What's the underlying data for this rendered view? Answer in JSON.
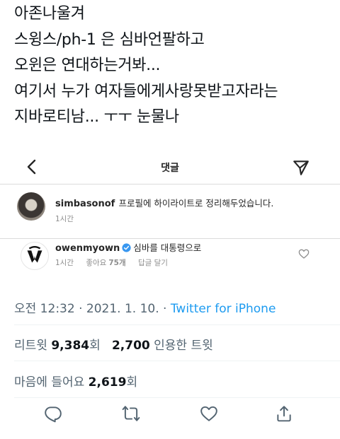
{
  "tweet": {
    "lines": [
      "아존나울겨",
      "스윙스/ph-1 은 심바언팔하고",
      "오윈은 연대하는거봐...",
      "여기서 누가 여자들에게사랑못받고자라는",
      "지바로티남... ㅜㅜ 눈물나"
    ]
  },
  "embed": {
    "title": "댓글",
    "comments": [
      {
        "user": "simbasonof",
        "text": "프로필에 하이라이트로 정리해두었습니다.",
        "time": "1시간"
      },
      {
        "user": "owenmyown",
        "text": "심바를 대통령으로",
        "time": "1시간",
        "likes_label": "좋아요",
        "likes_count": "75개",
        "reply_label": "답글 달기"
      }
    ]
  },
  "meta": {
    "time": "오전 12:32",
    "sep": " · ",
    "date": "2021. 1. 10.",
    "source": "Twitter for iPhone"
  },
  "stats": {
    "retweets_label": "리트윗",
    "retweets_count": "9,384",
    "retweets_unit": "회",
    "quotes_count": "2,700",
    "quotes_label": "인용한 트윗",
    "likes_label": "마음에 들어요",
    "likes_count": "2,619",
    "likes_unit": "회"
  },
  "icons": {
    "back": "chevron-left-icon",
    "send": "paper-plane-icon",
    "verified": "verified-badge-icon",
    "reply": "reply-icon",
    "retweet": "retweet-icon",
    "like": "heart-icon",
    "share": "share-icon"
  },
  "colors": {
    "link": "#1d9bf0",
    "secondary": "#536471",
    "verified": "#3897f0"
  }
}
